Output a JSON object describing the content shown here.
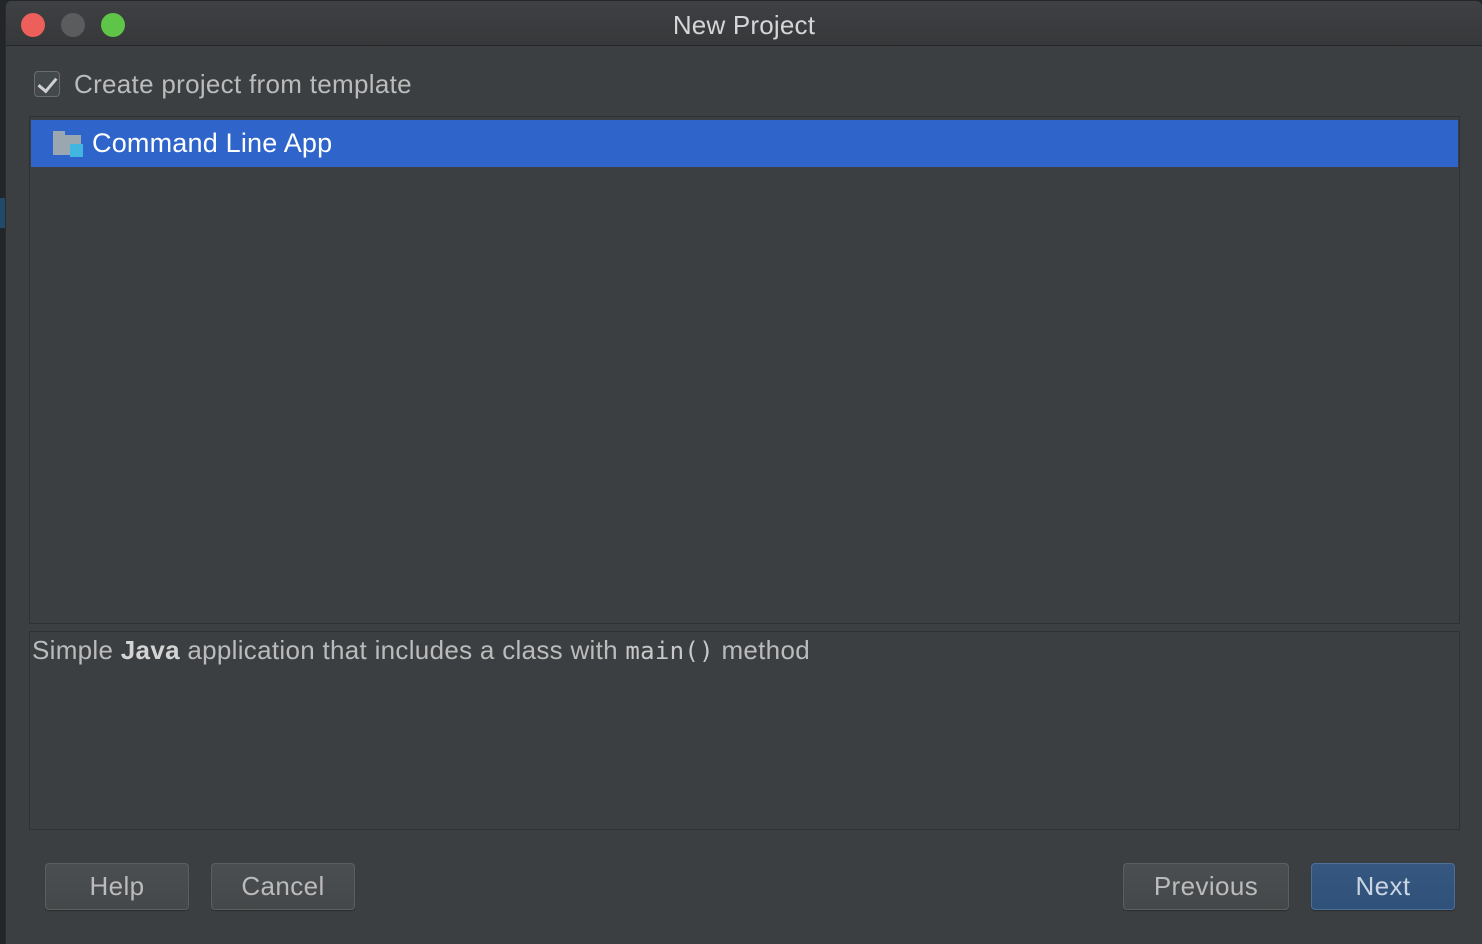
{
  "window": {
    "title": "New Project"
  },
  "template_option": {
    "checked": true,
    "label": "Create project from template"
  },
  "templates": [
    {
      "label": "Command Line App",
      "icon": "folder-icon",
      "selected": true
    }
  ],
  "description": {
    "prefix": "Simple ",
    "bold": "Java",
    "middle": " application that includes a class with ",
    "code": "main()",
    "suffix": " method"
  },
  "buttons": {
    "help": "Help",
    "cancel": "Cancel",
    "previous": "Previous",
    "next": "Next"
  },
  "colors": {
    "selection": "#2f65ca",
    "primary_button": "#365880",
    "panel": "#3c3f41"
  }
}
